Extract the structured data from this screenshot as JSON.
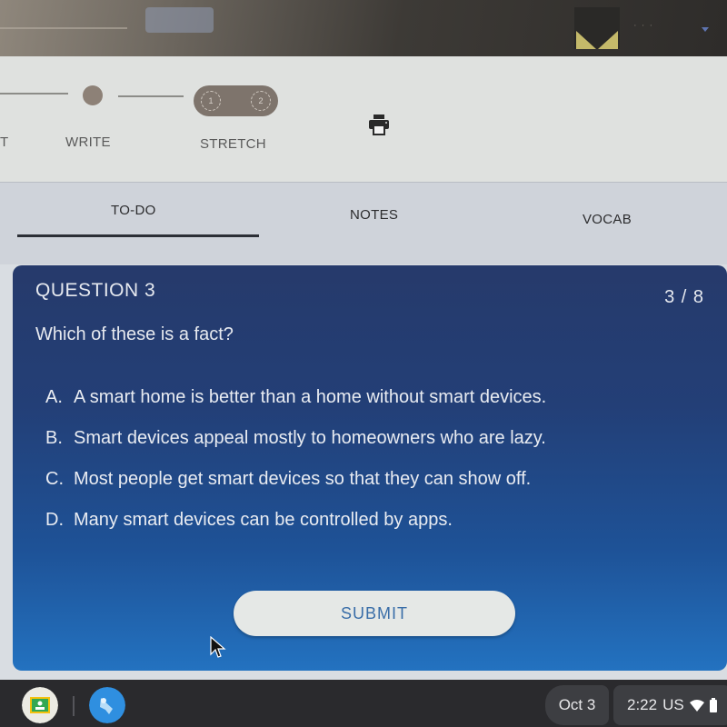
{
  "top_bar": {
    "user_name": "· · ·"
  },
  "stepper": {
    "steps": [
      {
        "label": "T"
      },
      {
        "label": "WRITE"
      },
      {
        "label": "STRETCH"
      }
    ],
    "stretch_substeps": [
      "1",
      "2"
    ]
  },
  "tabs": [
    {
      "label": "TO-DO",
      "active": true
    },
    {
      "label": "NOTES",
      "active": false
    },
    {
      "label": "VOCAB",
      "active": false
    }
  ],
  "question": {
    "title": "QUESTION 3",
    "counter": "3 / 8",
    "current": 3,
    "total": 8,
    "prompt": "Which of these is a fact?",
    "answers": [
      {
        "letter": "A.",
        "text": "A smart home is better than a home without smart devices."
      },
      {
        "letter": "B.",
        "text": "Smart devices appeal mostly to homeowners who are lazy."
      },
      {
        "letter": "C.",
        "text": "Most people get smart devices so that they can show off."
      },
      {
        "letter": "D.",
        "text": "Many smart devices can be controlled by apps."
      }
    ],
    "submit_label": "SUBMIT"
  },
  "taskbar": {
    "apps": [
      "google-classroom",
      "rocket-app"
    ],
    "date": "Oct 3",
    "time": "2:22",
    "locale": "US"
  },
  "colors": {
    "card_top": "#263a6b",
    "card_bottom": "#2372c0",
    "submit_text": "#3a6ea8"
  }
}
